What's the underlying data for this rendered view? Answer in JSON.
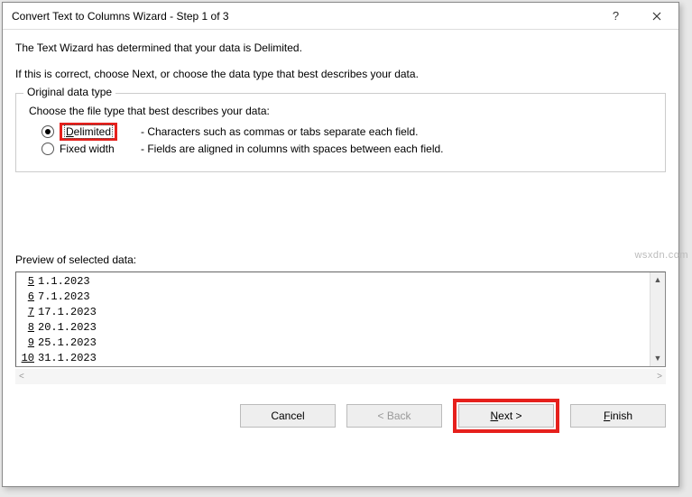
{
  "titlebar": {
    "title": "Convert Text to Columns Wizard - Step 1 of 3"
  },
  "intro": {
    "line1": "The Text Wizard has determined that your data is Delimited.",
    "line2": "If this is correct, choose Next, or choose the data type that best describes your data."
  },
  "group": {
    "legend": "Original data type",
    "prompt": "Choose the file type that best describes your data:",
    "options": [
      {
        "access": "D",
        "rest": "elimited",
        "desc": "- Characters such as commas or tabs separate each field.",
        "checked": true,
        "highlighted": true
      },
      {
        "access": "",
        "rest": "Fixed width",
        "desc": "- Fields are aligned in columns with spaces between each field.",
        "checked": false,
        "highlighted": false
      }
    ]
  },
  "preview": {
    "label": "Preview of selected data:",
    "rows": [
      {
        "idx": "5",
        "val": "1.1.2023"
      },
      {
        "idx": "6",
        "val": "7.1.2023"
      },
      {
        "idx": "7",
        "val": "17.1.2023"
      },
      {
        "idx": "8",
        "val": "20.1.2023"
      },
      {
        "idx": "9",
        "val": "25.1.2023"
      },
      {
        "idx": "10",
        "val": "31.1.2023"
      }
    ]
  },
  "buttons": {
    "cancel": "Cancel",
    "back": "< Back",
    "next_access": "N",
    "next_rest": "ext >",
    "finish": "Finish"
  },
  "watermark": "wsxdn.com"
}
